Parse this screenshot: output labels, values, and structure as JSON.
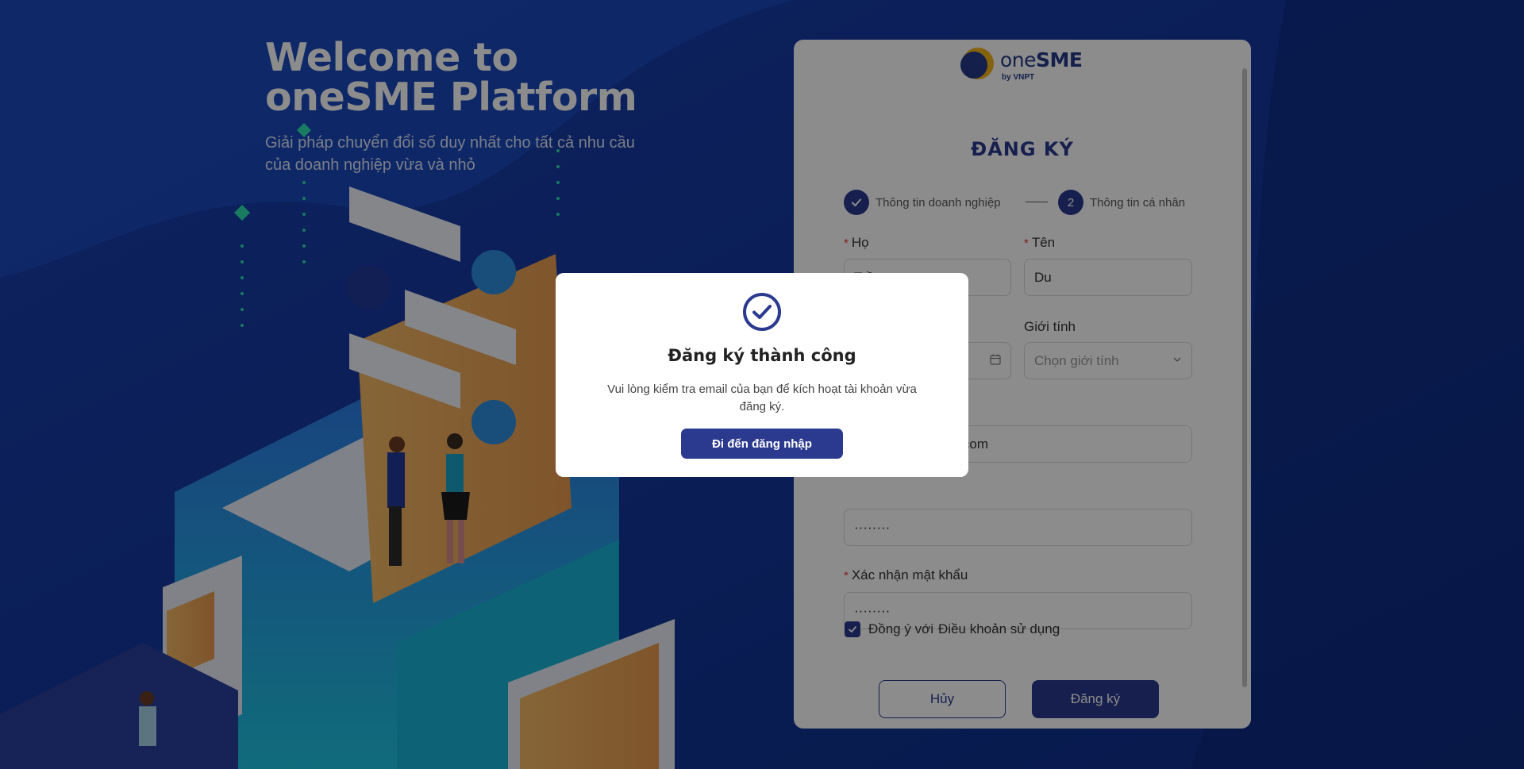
{
  "hero": {
    "title_line1": "Welcome to",
    "title_line2": "oneSME Platform",
    "subtitle_line1": "Giải pháp chuyển đổi số duy nhất cho tất cả nhu cầu",
    "subtitle_line2": "của doanh nghiệp vừa và nhỏ"
  },
  "logo": {
    "name_part1": "one",
    "name_part2": "SME",
    "by": "by VNPT"
  },
  "form": {
    "title": "ĐĂNG KÝ",
    "steps": [
      {
        "index": "1",
        "label": "Thông tin doanh nghiệp",
        "state": "done"
      },
      {
        "index": "2",
        "label": "Thông tin cá nhân",
        "state": "active"
      }
    ],
    "required_mark": "*",
    "last_name": {
      "label": "Họ",
      "value": "Trần"
    },
    "first_name": {
      "label": "Tên",
      "value": "Du"
    },
    "gender": {
      "label": "Giới tính",
      "placeholder": "Chọn giới tính"
    },
    "email": {
      "value": "com"
    },
    "password": {
      "value": "········"
    },
    "confirm_password": {
      "label": "Xác nhận mật khẩu",
      "value": "········"
    },
    "agree": {
      "text": "Đồng ý với",
      "link": "Điều khoản sử dụng",
      "checked": true
    },
    "cancel_label": "Hủy",
    "submit_label": "Đăng ký"
  },
  "modal": {
    "title": "Đăng ký thành công",
    "message": "Vui lòng kiểm tra email của bạn để kích hoạt tài khoản vừa đăng ký.",
    "button_label": "Đi đến đăng nhập"
  },
  "colors": {
    "brand": "#2b3a8f",
    "accent": "#f2b21b",
    "required": "#e03b3b"
  }
}
